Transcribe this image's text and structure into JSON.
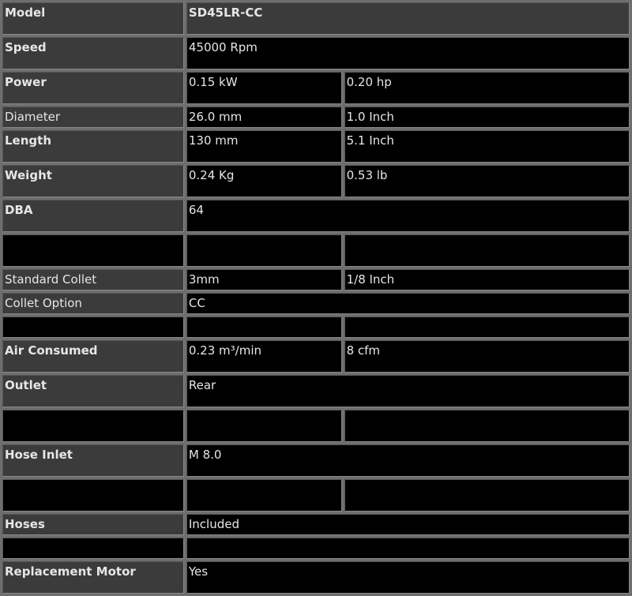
{
  "spec": {
    "model": {
      "label": "Model",
      "value": "SD45LR-CC"
    },
    "speed": {
      "label": "Speed",
      "value": "45000 Rpm"
    },
    "power": {
      "label": "Power",
      "metric": "0.15 kW",
      "imperial": "0.20 hp"
    },
    "diameter": {
      "label": "Diameter",
      "metric": "26.0 mm",
      "imperial": "1.0 Inch"
    },
    "length": {
      "label": "Length",
      "metric": "130 mm",
      "imperial": "5.1 Inch"
    },
    "weight": {
      "label": "Weight",
      "metric": "0.24 Kg",
      "imperial": "0.53 lb"
    },
    "dba": {
      "label": "DBA",
      "value": "64"
    },
    "standard_collet": {
      "label": "Standard Collet",
      "metric": "3mm",
      "imperial": "1/8 Inch"
    },
    "collet_option": {
      "label": "Collet Option",
      "value": "CC"
    },
    "air_consumed": {
      "label": "Air Consumed",
      "metric": "0.23 m³/min",
      "imperial": "8 cfm"
    },
    "outlet": {
      "label": "Outlet",
      "value": "Rear"
    },
    "hose_inlet": {
      "label": "Hose Inlet",
      "value": "M 8.0"
    },
    "hoses": {
      "label": "Hoses",
      "value": "Included"
    },
    "replacement_motor": {
      "label": "Replacement Motor",
      "value": "Yes"
    }
  }
}
